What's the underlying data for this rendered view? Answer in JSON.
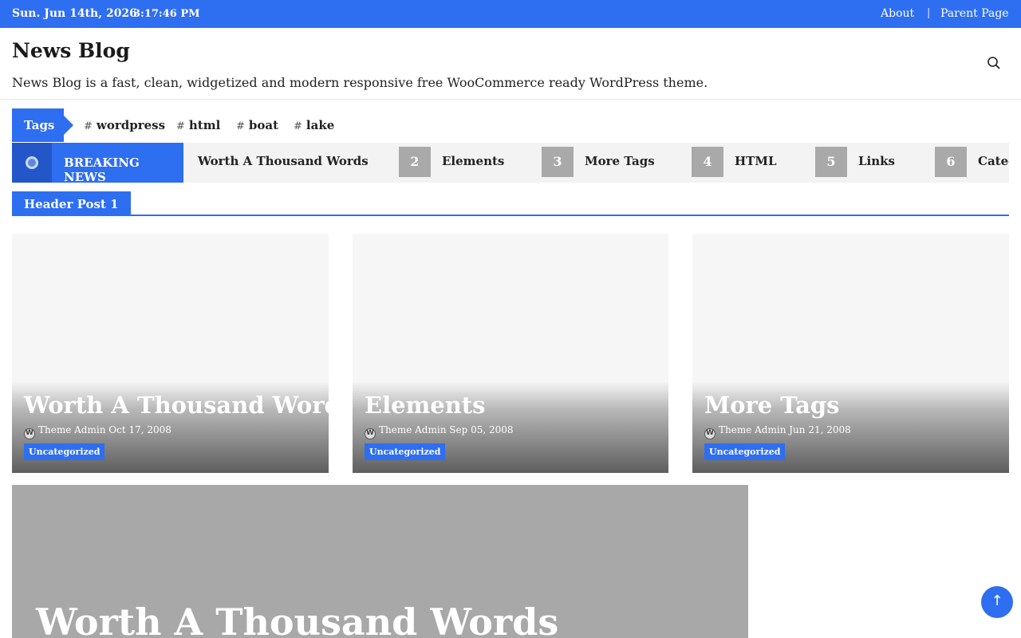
{
  "topbar": {
    "date": "Sun. Jun 14th, 2026",
    "time": "3:17:46 PM",
    "menu": [
      {
        "label": "About"
      },
      {
        "label": "Parent Page"
      }
    ],
    "separator": "|"
  },
  "header": {
    "title": "News Blog",
    "description": "News Blog is a fast, clean, widgetized and modern responsive free WooCommerce ready WordPress theme.",
    "search_icon": "search-icon"
  },
  "tags": {
    "label": "Tags",
    "items": [
      {
        "hash": "#",
        "label": "wordpress"
      },
      {
        "hash": "#",
        "label": "html"
      },
      {
        "hash": "#",
        "label": "boat"
      },
      {
        "hash": "#",
        "label": "lake"
      }
    ]
  },
  "breaking": {
    "label": "BREAKING NEWS",
    "items": [
      {
        "num": "",
        "title": "Worth A Thousand Words"
      },
      {
        "num": "2",
        "title": "Elements"
      },
      {
        "num": "3",
        "title": "More Tags"
      },
      {
        "num": "4",
        "title": "HTML"
      },
      {
        "num": "5",
        "title": "Links"
      },
      {
        "num": "6",
        "title": "Categ"
      }
    ]
  },
  "section": {
    "title": "Header Post 1"
  },
  "cards": [
    {
      "title": "Worth A Thousand Words",
      "author": "Theme Admin",
      "date": "Oct 17, 2008",
      "category": "Uncategorized"
    },
    {
      "title": "Elements",
      "author": "Theme Admin",
      "date": "Sep 05, 2008",
      "category": "Uncategorized"
    },
    {
      "title": "More Tags",
      "author": "Theme Admin",
      "date": "Jun 21, 2008",
      "category": "Uncategorized"
    }
  ],
  "big_card": {
    "title": "Worth A Thousand Words"
  },
  "back_to_top": {
    "glyph": "↑"
  },
  "colors": {
    "accent": "#2e6ef0",
    "breaking_icon_bg": "#2356c9",
    "number_badge": "#a9a9a9"
  }
}
